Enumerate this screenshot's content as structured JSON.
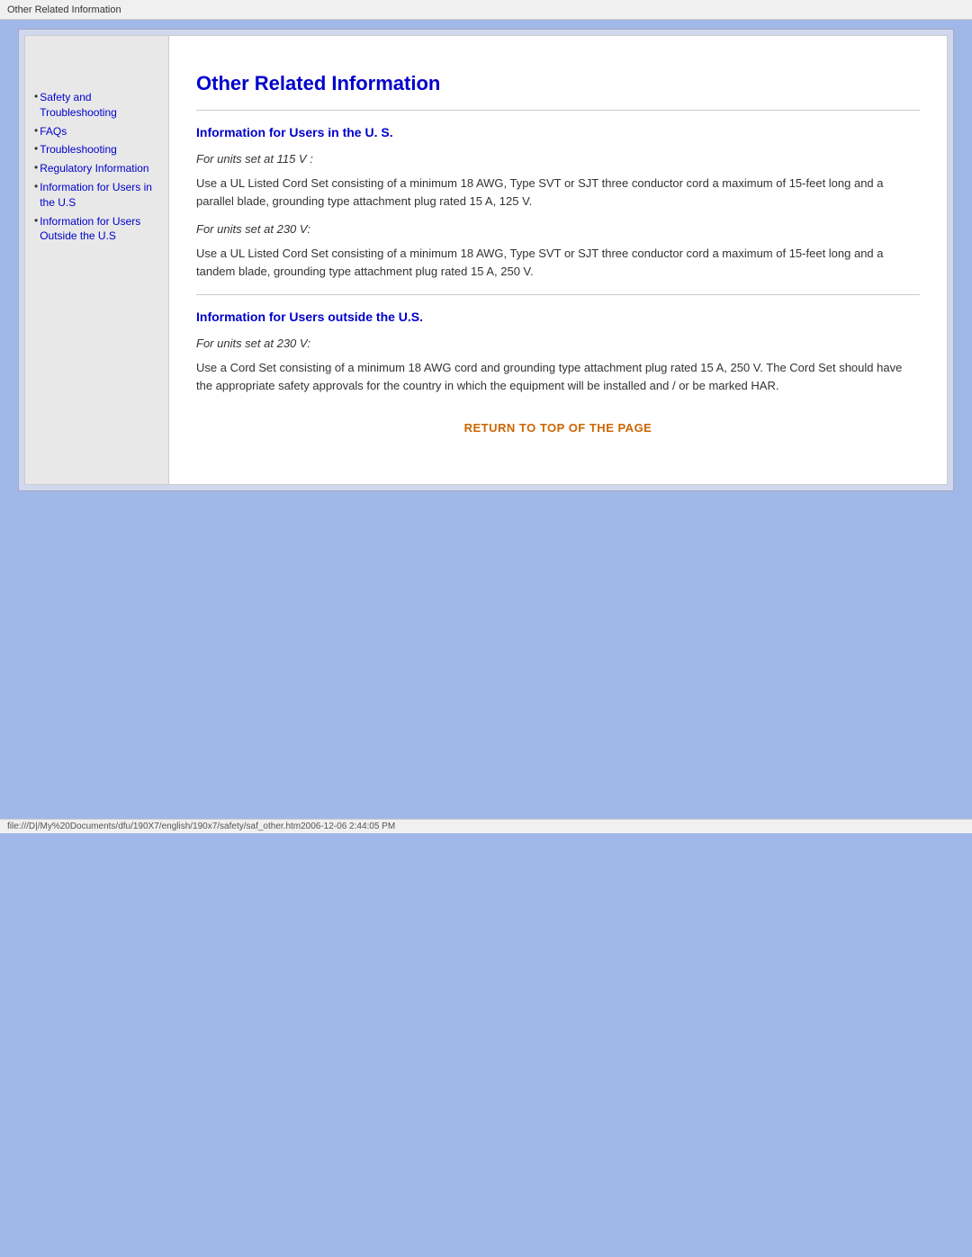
{
  "titlebar": {
    "text": "Other Related Information"
  },
  "sidebar": {
    "items": [
      {
        "label": "Safety and Troubleshooting",
        "href": "#"
      },
      {
        "label": "FAQs",
        "href": "#"
      },
      {
        "label": "Troubleshooting",
        "href": "#"
      },
      {
        "label": "Regulatory Information",
        "href": "#"
      },
      {
        "label": "Information for Users in the U.S",
        "href": "#"
      },
      {
        "label": "Information for Users Outside the U.S",
        "href": "#"
      }
    ]
  },
  "main": {
    "page_title": "Other Related Information",
    "section1": {
      "title": "Information for Users in the U. S.",
      "block1_italic": "For units set at 115 V :",
      "block1_body": "Use a UL Listed Cord Set consisting of a minimum 18 AWG, Type SVT or SJT three conductor cord a maximum of 15-feet long and a parallel blade, grounding type attachment plug rated 15 A, 125 V.",
      "block2_italic": "For units set at 230 V:",
      "block2_body": "Use a UL Listed Cord Set consisting of a minimum 18 AWG, Type SVT or SJT three conductor cord a maximum of 15-feet long and a tandem blade, grounding type attachment plug rated 15 A, 250 V."
    },
    "section2": {
      "title": "Information for Users outside the U.S.",
      "block1_italic": "For units set at 230 V:",
      "block1_body": "Use a Cord Set consisting of a minimum 18 AWG cord and grounding type attachment plug rated 15 A, 250 V. The Cord Set should have the appropriate safety approvals for the country in which the equipment will be installed and / or be marked HAR."
    },
    "return_link": "RETURN TO TOP OF THE PAGE"
  },
  "statusbar": {
    "text": "file:///D|/My%20Documents/dfu/190X7/english/190x7/safety/saf_other.htm2006-12-06 2:44:05 PM"
  }
}
